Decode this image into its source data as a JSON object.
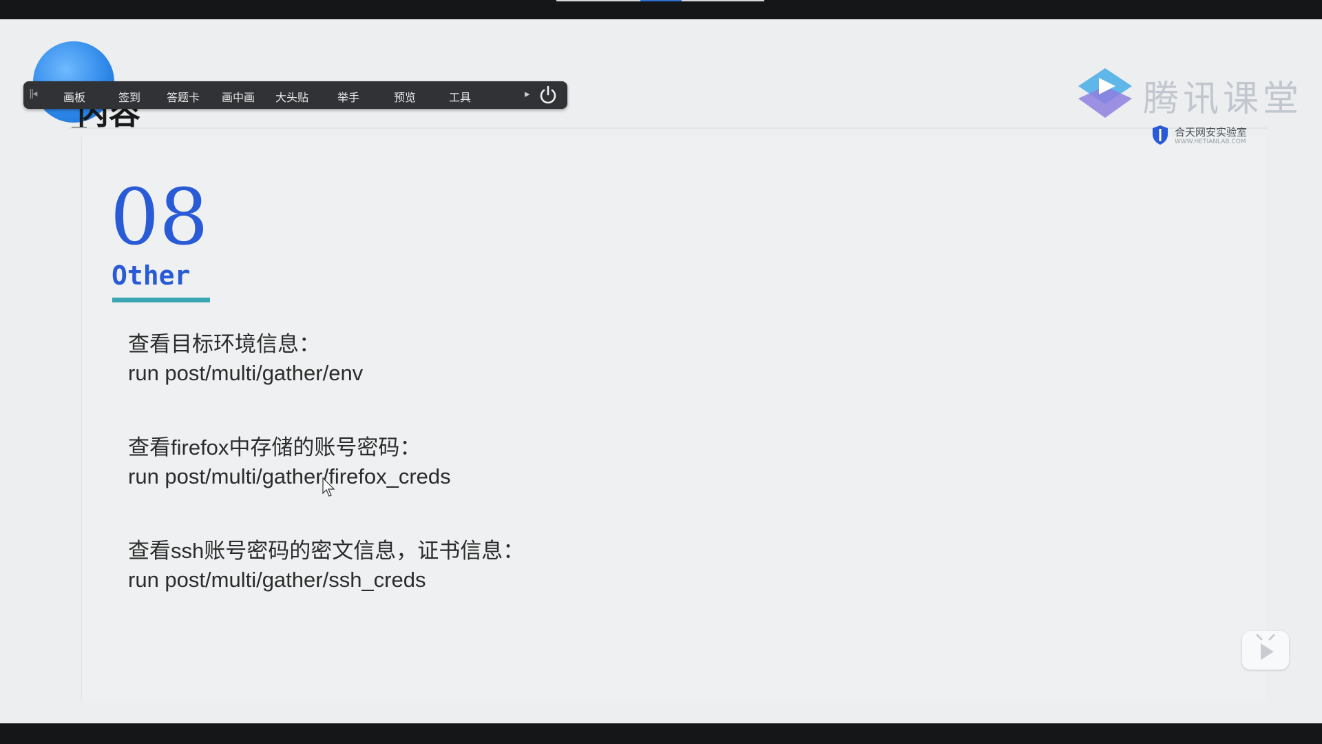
{
  "toolbar": {
    "items": [
      "画板",
      "签到",
      "答题卡",
      "画中画",
      "大头贴",
      "举手",
      "预览",
      "工具"
    ]
  },
  "logo": {
    "brand": "腾讯课堂",
    "sub_brand": "合天网安实验室",
    "sub_url": "WWW.HETIANLAB.COM"
  },
  "slide": {
    "heading_partial": "内容",
    "section_number": "08",
    "section_title": "Other",
    "items": [
      {
        "label": "查看目标环境信息：",
        "command": "run post/multi/gather/env"
      },
      {
        "label": "查看firefox中存储的账号密码：",
        "command": "run post/multi/gather/firefox_creds"
      },
      {
        "label": "查看ssh账号密码的密文信息，证书信息：",
        "command": "run post/multi/gather/ssh_creds"
      }
    ]
  },
  "colors": {
    "accent": "#2a5bd7",
    "underline": "#3aa5b3",
    "toolbar_bg": "#303235",
    "slide_bg": "#eceeef"
  },
  "icons": [
    "collapse-toolbar-icon",
    "expand-arrow-icon",
    "power-icon",
    "tencent-classroom-logo-icon",
    "shield-logo-icon",
    "mouse-cursor-icon",
    "bilibili-play-icon"
  ]
}
